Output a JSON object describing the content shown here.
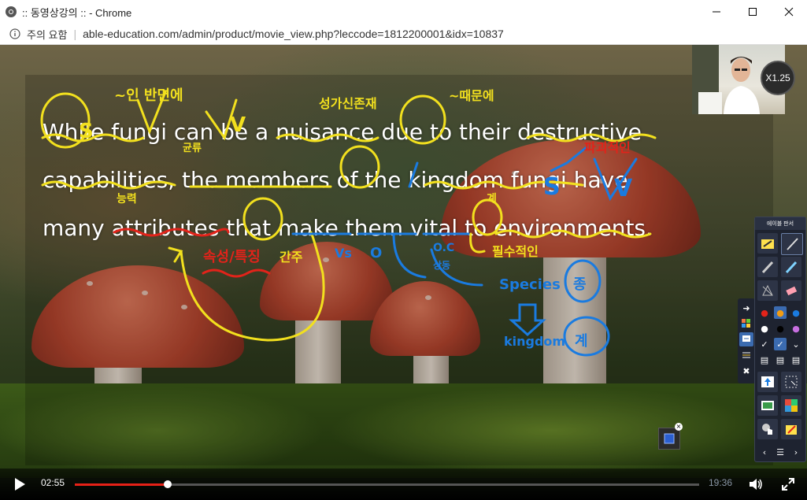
{
  "window": {
    "title": ":: 동영상강의 :: - Chrome",
    "controls": [
      "minimize",
      "maximize",
      "close"
    ]
  },
  "address_bar": {
    "security_label": "주의 요함",
    "url": "able-education.com/admin/product/movie_view.php?leccode=1812200001&idx=10837"
  },
  "lecture": {
    "line1": "While fungi can be a nuisance due to their destructive",
    "line2": "capabilities, the members of the kingdom fungi have",
    "line3": "many attributes that make them vital to environments."
  },
  "annotations": {
    "note_1": "~인 반면에",
    "note_2": "성가신존재",
    "note_3": "~때문에",
    "note_4": "균류",
    "note_5": "파괴적인",
    "note_6": "능력",
    "note_7": "계",
    "note_8": "속성/특징",
    "note_9": "간주",
    "note_10": "Vs",
    "note_11": "O",
    "note_12": "O.C",
    "note_13": "필수적인",
    "note_14": "Species",
    "note_15": "종",
    "note_16": "kingdom",
    "note_17": "계",
    "note_18": "S",
    "note_19": "V",
    "note_20": "S",
    "note_21": "V",
    "note_22": "상동",
    "colors": {
      "yellow": "#f2e01e",
      "red": "#e2231a",
      "blue": "#1a7be0"
    }
  },
  "player": {
    "speed_label": "X1.25",
    "current_time": "02:55",
    "total_time": "19:36",
    "progress_fraction": 0.1488
  },
  "pen_panel": {
    "header": "에이블 판서"
  }
}
